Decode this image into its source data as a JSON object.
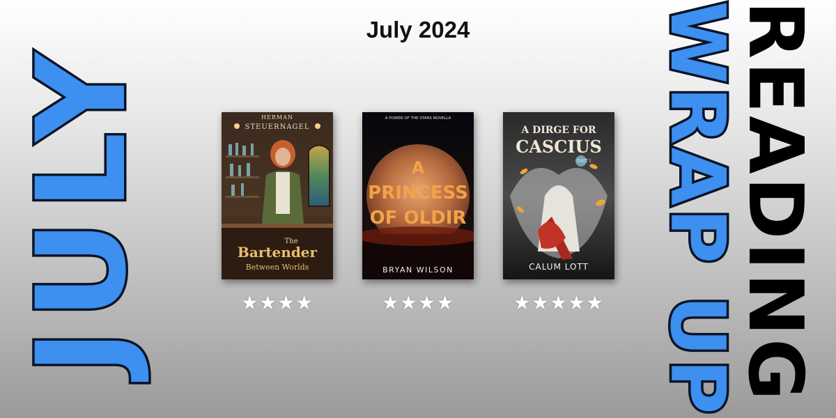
{
  "heading": "July 2024",
  "left_title": "JULY",
  "right_title_outer": "READING",
  "right_title_inner": "WRAP UP",
  "colors": {
    "accent": "#3d8ff0",
    "outline": "#0a1426"
  },
  "books": [
    {
      "title_line1": "The",
      "title_line2": "Bartender",
      "title_line3": "Between Worlds",
      "author_line1": "HERMAN",
      "author_line2": "STEUERNAGEL",
      "stars": "★★★★",
      "rating": 4
    },
    {
      "series": "A POWER OF THE STARS NOVELLA",
      "title_line1": "A",
      "title_line2": "PRINCESS",
      "title_line3": "OF OLDIR",
      "author": "BRYAN WILSON",
      "stars": "★★★★",
      "rating": 4
    },
    {
      "title_line1": "A DIRGE FOR",
      "title_line2": "CASCIUS",
      "part": "PART I",
      "author": "CALUM LOTT",
      "stars": "★★★★★",
      "rating": 5
    }
  ]
}
